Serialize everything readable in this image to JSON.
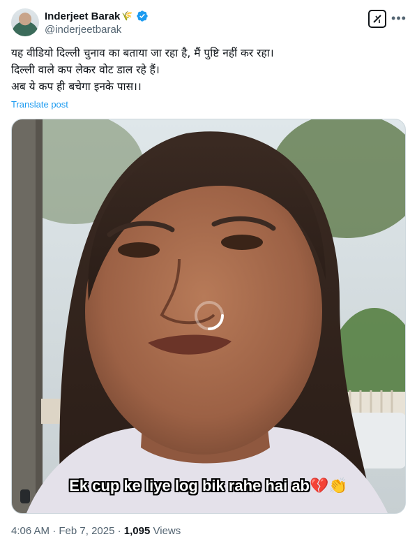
{
  "author": {
    "display_name": "Inderjeet Barak",
    "handle": "@inderjeetbarak",
    "wheat_icon": "🌾",
    "verified": true,
    "verified_color": "#1d9bf0"
  },
  "actions": {
    "grok_icon": "grok-icon",
    "more_icon": "•••"
  },
  "tweet": {
    "lines": [
      "यह वीडियो दिल्ली चुनाव का बताया जा रहा है, मैं पुष्टि नहीं कर रहा।",
      "दिल्ली वाले कप लेकर वोट डाल रहे हैं।",
      "अब ये कप ही बचेगा इनके पास।।"
    ],
    "translate_label": "Translate post"
  },
  "video": {
    "caption": "Ek cup ke liye log bik rahe hai ab",
    "caption_emoji": "💔👏"
  },
  "meta": {
    "time": "4:06 AM",
    "separator": " · ",
    "date": "Feb 7, 2025",
    "views_count": "1,095",
    "views_label": " Views"
  },
  "colors": {
    "accent": "#1d9bf0",
    "text": "#0f1419",
    "secondary": "#536471"
  }
}
